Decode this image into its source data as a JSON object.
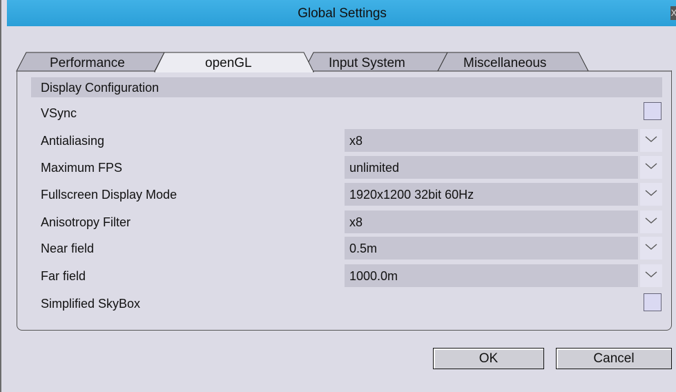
{
  "window": {
    "title": "Global Settings",
    "close_glyph": "X"
  },
  "tabs": [
    {
      "label": "Performance",
      "active": false
    },
    {
      "label": "openGL",
      "active": true
    },
    {
      "label": "Input System",
      "active": false
    },
    {
      "label": "Miscellaneous",
      "active": false
    }
  ],
  "section": {
    "title": "Display Configuration"
  },
  "rows": [
    {
      "label": "VSync",
      "type": "checkbox",
      "checked": false
    },
    {
      "label": "Antialiasing",
      "type": "select",
      "value": "x8"
    },
    {
      "label": "Maximum FPS",
      "type": "select",
      "value": "unlimited"
    },
    {
      "label": "Fullscreen Display Mode",
      "type": "select",
      "value": "1920x1200 32bit 60Hz"
    },
    {
      "label": "Anisotropy Filter",
      "type": "select",
      "value": "x8"
    },
    {
      "label": "Near field",
      "type": "select",
      "value": "0.5m"
    },
    {
      "label": "Far field",
      "type": "select",
      "value": "1000.0m"
    },
    {
      "label": "Simplified SkyBox",
      "type": "checkbox",
      "checked": false
    }
  ],
  "buttons": {
    "ok": "OK",
    "cancel": "Cancel"
  },
  "icons": {
    "close": "close-icon",
    "dropdown": "chevron-down-icon"
  },
  "colors": {
    "titlebar": "#2ba0d8",
    "background": "#dcdbe6",
    "field": "#c6c5d2",
    "active_tab": "#ececf2"
  }
}
